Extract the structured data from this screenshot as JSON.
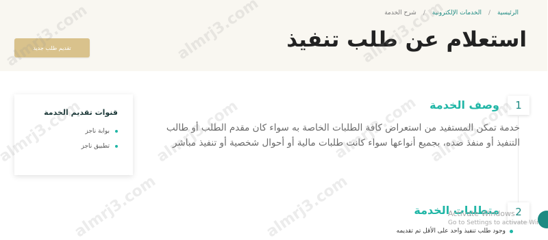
{
  "breadcrumb": {
    "home": "الرئيسية",
    "sep1": "/",
    "eservices": "الخدمات الإلكترونية",
    "sep2": "/",
    "current": "شرح الخدمة"
  },
  "page_title": "استعلام عن طلب تنفيذ",
  "new_request_button": "تقديم طلب جديد",
  "sections": [
    {
      "number": "1",
      "title": "وصف الخدمة",
      "description": "خدمة تمكن المستفيد من استعراض كافة الطلبات الخاصة به سواء كان مقدم الطلب أو طالب التنفيذ أو منفذ ضده، بجميع أنواعها سواء كانت طلبات مالية أو أحوال شخصية أو تنفيذ مباشر"
    },
    {
      "number": "2",
      "title": "متطلبات الخدمة",
      "requirement": "وجود طلب تنفيذ واحد على الأقل تم تقديمه"
    }
  ],
  "channels": {
    "title": "قنوات تقديم الخدمة",
    "items": [
      "بوابة ناجز",
      "تطبيق ناجز"
    ]
  },
  "windows_activation": {
    "line1": "Activate Windows",
    "line2": "Go to Settings to activate Windows."
  },
  "watermark": "almrj3.com",
  "colors": {
    "accent": "#20b6a6",
    "gold": "#d9c28c",
    "header_bg": "#f9f7f1"
  }
}
